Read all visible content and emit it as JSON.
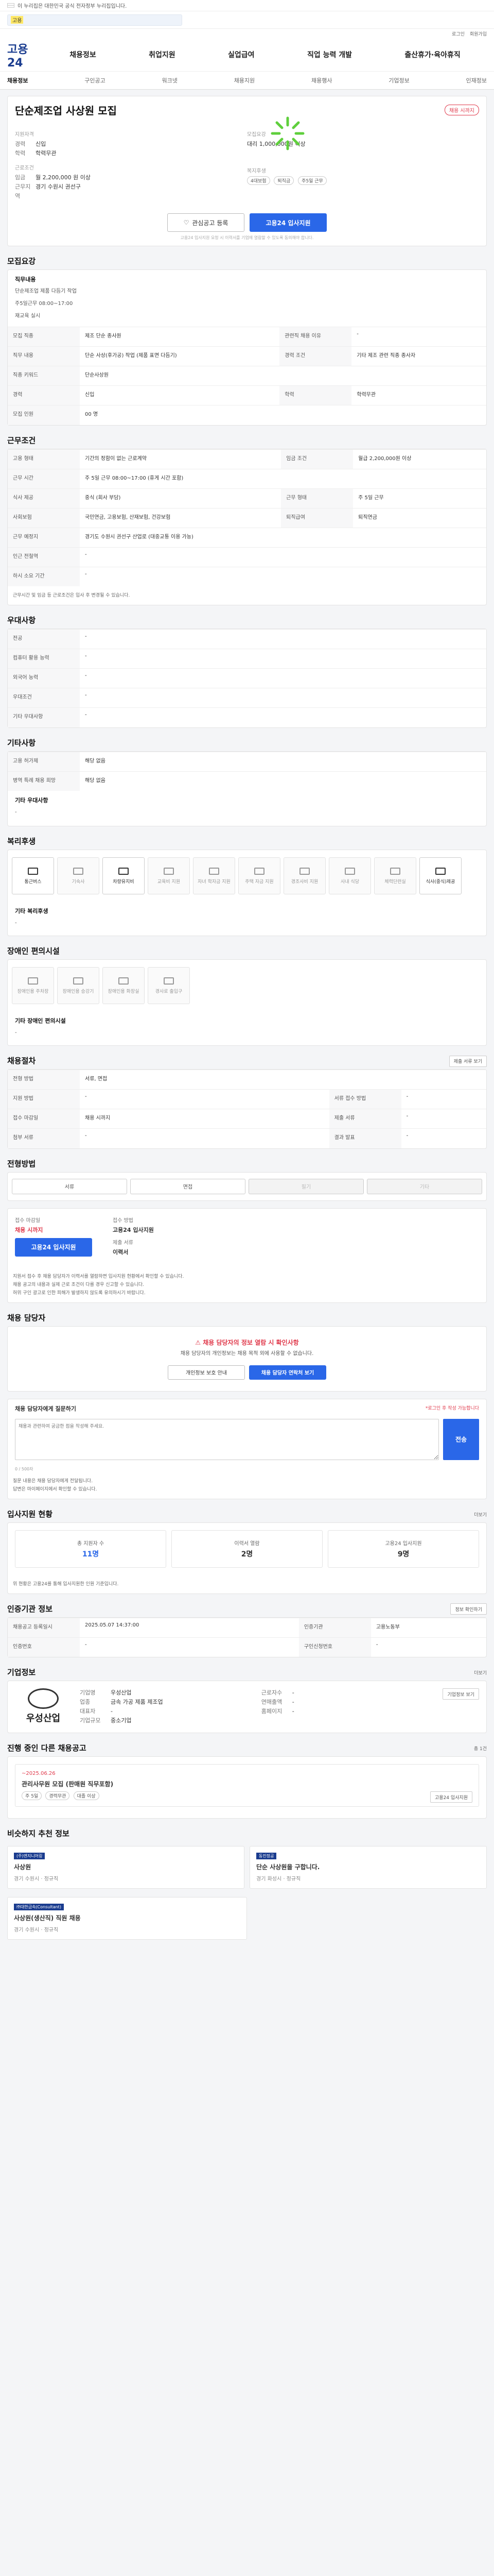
{
  "gov_banner": {
    "text": "이 누리집은 대한민국 공식 전자정부 누리집입니다."
  },
  "search": {
    "highlight": "고용",
    "placeholder": ""
  },
  "util": [
    "로그인",
    "회원가입"
  ],
  "header": {
    "logo": "고용24",
    "nav": [
      "채용정보",
      "취업지원",
      "실업급여",
      "직업 능력 개발",
      "출산휴가·육아휴직"
    ]
  },
  "subnav": {
    "items": [
      "채용정보",
      "구인공고",
      "워크넷",
      "채용지원",
      "채용행사",
      "기업정보",
      "인재정보"
    ]
  },
  "job": {
    "title": "단순제조업 사상원 모집",
    "badge": "채용 시까지",
    "summary_left_label": "지원자격",
    "summary_left": [
      [
        "경력",
        "신입"
      ],
      [
        "학력",
        "학력무관"
      ]
    ],
    "cond_label": "근로조건",
    "cond": [
      [
        "임금",
        "월 2,200,000 원 이상"
      ],
      [
        "근무지역",
        "경기 수원시 권선구"
      ]
    ],
    "center_label": "모집요강",
    "center": [
      "대리 1,000,000원 이상"
    ],
    "welfare_label": "복지후생",
    "tags": [
      "4대보험",
      "퇴직금",
      "주5일 근무"
    ]
  },
  "actions": {
    "save": "관심공고 등록",
    "apply": "고용24 입사지원"
  },
  "notice": "고용24 입사지원 요청 시 이력서를 기업에 열람할 수 있도록 동의해야 합니다.",
  "sec_recruit": {
    "title": "모집요강",
    "job_label": "직무내용",
    "job_lines": [
      "단순제조업 제품 다듬기 작업",
      "주5일근무 08:00~17:00",
      "재교육 실시"
    ],
    "rows": [
      [
        "모집 직종",
        "제조 단순 종사원",
        "관련직 채용 이유",
        "-"
      ],
      [
        "직무 내용",
        "단순 사상(후가공) 작업 (제품 표면 다듬기)",
        "경력 조건",
        "기타 제조 관련 직종 종사자"
      ],
      [
        "직종 키워드",
        "단순사상원",
        "",
        ""
      ],
      [
        "경력",
        "신입",
        "학력",
        "학력무관"
      ],
      [
        "모집 인원",
        "00 명",
        "",
        ""
      ]
    ]
  },
  "sec_cond": {
    "title": "근무조건",
    "rows": [
      [
        "고용 형태",
        "기간의 정함이 없는 근로계약",
        "임금 조건",
        "월급 2,200,000원 이상"
      ],
      [
        "근무 시간",
        "주 5일 근무 08:00~17:00 (휴게 시간 포함)",
        "",
        ""
      ],
      [
        "식사 제공",
        "중식 (회사 부담)",
        "근무 형태",
        "주 5일 근무"
      ],
      [
        "사회보험",
        "국민연금, 고용보험, 산재보험, 건강보험",
        "퇴직급여",
        "퇴직연금"
      ],
      [
        "근무 예정지",
        "경기도 수원시 권선구 산업로 (대중교통 이용 가능)",
        "",
        ""
      ],
      [
        "인근 전철역",
        "-",
        "",
        ""
      ],
      [
        "하시 소요 기간",
        "-",
        "",
        ""
      ]
    ],
    "foot": "근무시간 및 임금 등 근로조건은 입사 후 변경될 수 있습니다."
  },
  "sec_pref": {
    "title": "우대사항",
    "rows": [
      [
        "전공",
        "-"
      ],
      [
        "컴퓨터 활용 능력",
        "-"
      ],
      [
        "외국어 능력",
        "-"
      ],
      [
        "우대조건",
        "-"
      ],
      [
        "기타 우대사항",
        "-"
      ]
    ]
  },
  "sec_etc": {
    "title": "기타사항",
    "rows": [
      [
        "고용 허가제",
        "해당 없음"
      ],
      [
        "병역 특례 채용 희망",
        "해당 없음"
      ]
    ],
    "sub": "기타 우대사항",
    "empty": "-"
  },
  "sec_welfare": {
    "title": "복리후생",
    "items": [
      {
        "label": "통근버스",
        "on": true
      },
      {
        "label": "기숙사",
        "on": false
      },
      {
        "label": "차량유지비",
        "on": true
      },
      {
        "label": "교육비 지원",
        "on": false
      },
      {
        "label": "자녀 학자금 지원",
        "on": false
      },
      {
        "label": "주택 자금 지원",
        "on": false
      },
      {
        "label": "경조사비 지원",
        "on": false
      },
      {
        "label": "사내 식당",
        "on": false
      },
      {
        "label": "체력단련실",
        "on": false
      },
      {
        "label": "식사(중식)제공",
        "on": true
      }
    ],
    "other_label": "기타 복리후생",
    "other_value": "-"
  },
  "sec_disabled": {
    "title": "장애인 편의시설",
    "items": [
      "장애인용 주차장",
      "장애인용 승강기",
      "장애인용 화장실",
      "경사로 출입구"
    ],
    "other_label": "기타 장애인 편의시설",
    "other_value": "-"
  },
  "sec_process": {
    "title": "채용절차",
    "btn": "제출 서류 보기",
    "rows": [
      [
        "전형 방법",
        "서류, 면접",
        "",
        ""
      ],
      [
        "지원 방법",
        "-",
        "서류 접수 방법",
        "-"
      ],
      [
        "접수 마감일",
        "채용 시까지",
        "제출 서류",
        "-"
      ],
      [
        "첨부 서류",
        "-",
        "결과 발표",
        "-"
      ]
    ]
  },
  "sec_method": {
    "title": "전형방법",
    "items": [
      {
        "label": "서류",
        "on": true
      },
      {
        "label": "면접",
        "on": true
      },
      {
        "label": "필기",
        "on": false
      },
      {
        "label": "기타",
        "on": false
      }
    ]
  },
  "sec_apply": {
    "deadline_label": "접수 마감일",
    "deadline_value": "채용 시까지",
    "method_label": "접수 방법",
    "method_value": "고용24 입사지원",
    "count_label": "제출 서류",
    "count_value": "이력서",
    "btn": "고용24 입사지원",
    "bullets": [
      "지원서 접수 후 채용 담당자가 이력서를 열람하면 입사지원 현황에서 확인할 수 있습니다.",
      "채용 공고의 내용과 실제 근로 조건이 다를 경우 신고할 수 있습니다.",
      "허위 구인 광고로 인한 피해가 발생하지 않도록 유의하시기 바랍니다."
    ]
  },
  "sec_contact": {
    "title": "채용 담당자",
    "t1": "채용 담당자의 정보 열람 시 확인사항",
    "t2": "채용 담당자의 개인정보는 채용 목적 외에 사용할 수 없습니다.",
    "btn1": "개인정보 보호 안내",
    "btn2": "채용 담당자 연락처 보기"
  },
  "sec_inq": {
    "title": "채용 담당자에게 질문하기",
    "note": "*로그인 후 작성 가능합니다",
    "placeholder": "채용과 관련하여 궁금한 점을 작성해 주세요.",
    "btn": "전송",
    "counter": "0 / 500자",
    "foot": [
      "질문 내용은 채용 담당자에게 전달됩니다.",
      "답변은 마이페이지에서 확인할 수 있습니다."
    ]
  },
  "sec_stats": {
    "title": "입사지원 현황",
    "more": "더보기",
    "items": [
      {
        "label": "총 지원자 수",
        "value": "11명"
      },
      {
        "label": "이력서 열람",
        "value": "2명"
      },
      {
        "label": "고용24 입사지원",
        "value": "9명"
      }
    ],
    "foot": "위 현황은 고용24를 통해 입사지원한 인원 기준입니다."
  },
  "sec_info": {
    "title": "인증기관 정보",
    "btn": "정보 확인하기",
    "rows": [
      [
        "채용공고 등록일시",
        "2025.05.07 14:37:00",
        "인증기관",
        "고용노동부"
      ],
      [
        "인증번호",
        "-",
        "구인신청번호",
        "-"
      ]
    ]
  },
  "sec_company": {
    "title": "기업정보",
    "more": "더보기",
    "logo": "우성산업",
    "left": [
      [
        "기업명",
        "우성산업"
      ],
      [
        "업종",
        "금속 가공 제품 제조업"
      ],
      [
        "대표자",
        "-"
      ],
      [
        "기업규모",
        "중소기업"
      ]
    ],
    "right": [
      [
        "근로자수",
        "-"
      ],
      [
        "연매출액",
        "-"
      ],
      [
        "홈페이지",
        "-"
      ]
    ],
    "btn": "기업정보 보기"
  },
  "sec_other": {
    "title": "진행 중인 다른 채용공고",
    "note": "총 1건",
    "card": {
      "date": "~2025.06.26",
      "title": "관리사무원 모집 (판매원 직무포함)",
      "tags": [
        "주 5일",
        "경력무관",
        "대졸 이상"
      ],
      "btn": "고용24 입사지원"
    }
  },
  "sec_rec": {
    "title": "비슷하지 추천 정보",
    "items": [
      {
        "company": "(주)엔지니어링",
        "title": "사상원",
        "meta": "경기 수원시 · 정규직"
      },
      {
        "company": "동진정공",
        "title": "단순 사상원을 구합니다.",
        "meta": "경기 화성시 · 정규직"
      },
      {
        "company": "㈜대한금속(Consultant)",
        "title": "사상원(생산직) 직원 채용",
        "meta": "경기 수원시 · 정규직"
      }
    ]
  }
}
